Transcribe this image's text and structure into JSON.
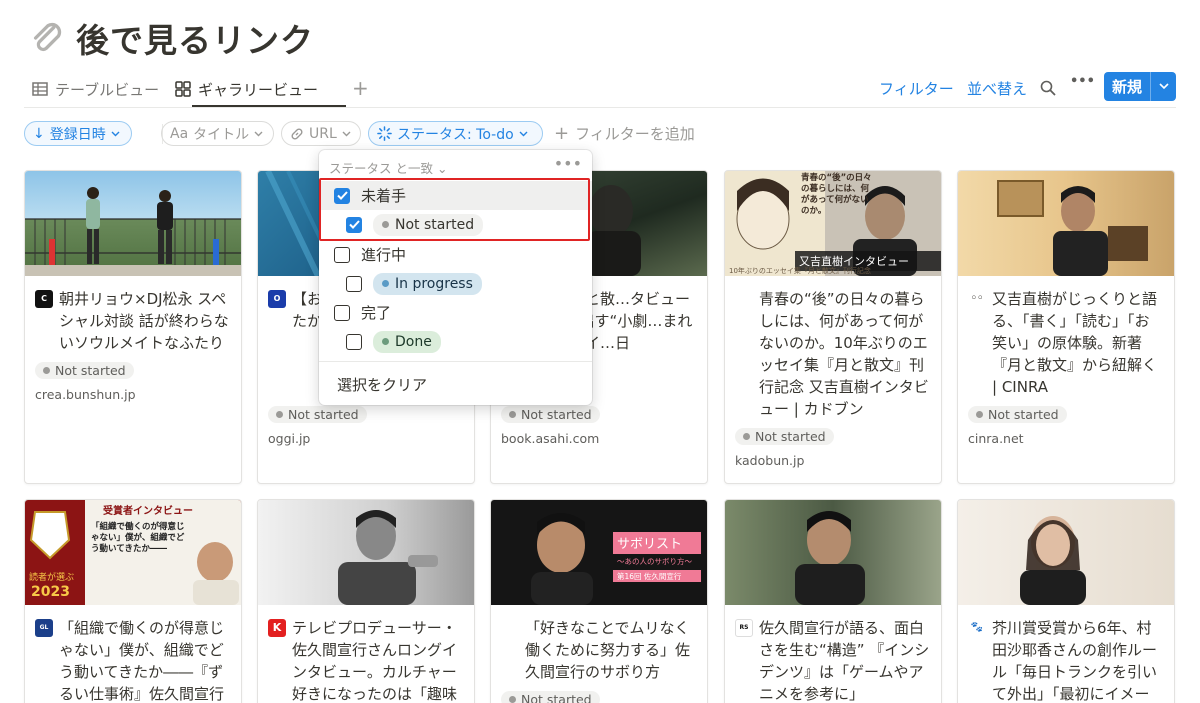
{
  "page": {
    "title": "後で見るリンク"
  },
  "tabs": [
    {
      "label": "テーブルビュー"
    },
    {
      "label": "ギャラリービュー"
    }
  ],
  "toolbar": {
    "filter": "フィルター",
    "sort": "並べ替え",
    "more": "•••",
    "new": "新規"
  },
  "filters": {
    "sort_chip": "登録日時",
    "title_chip": "タイトル",
    "title_prefix": "Aa",
    "url_chip": "URL",
    "status_chip": "ステータス: To-do",
    "add_filter": "フィルターを追加"
  },
  "popup": {
    "header": "ステータス と一致",
    "more": "•••",
    "groups": [
      {
        "label": "未着手",
        "option": "Not started",
        "checked": true
      },
      {
        "label": "進行中",
        "option": "In progress",
        "checked": false
      },
      {
        "label": "完了",
        "option": "Done",
        "checked": false
      }
    ],
    "clear": "選択をクリア"
  },
  "cards": [
    {
      "title": "朝井リョウ×DJ松永 スペシャル対談 話が終わらないソウルメイトなふたり",
      "status": "Not started",
      "site": "crea.bunshun.jp"
    },
    {
      "title": "【おさん…にく…ど、…たか",
      "status": "Not started",
      "site": "oggi.jp"
    },
    {
      "title": "さん「月と散…タビュー 0か…み出す“小劇…まれたエッセイ…日",
      "status": "Not started",
      "site": "book.asahi.com"
    },
    {
      "title": "青春の“後”の日々の暮らしには、何があって何がないのか。10年ぶりのエッセイ集『月と散文』刊行記念 又吉直樹インタビュー | カドブン",
      "status": "Not started",
      "site": "kadobun.jp"
    },
    {
      "title": "又吉直樹がじっくりと語る、「書く」「読む」「お笑い」の原体験。新著『月と散文』から紐解く | CINRA",
      "status": "Not started",
      "site": "cinra.net"
    },
    {
      "title": "「組織で働くのが得意じゃない」僕が、組織でどう動いてきたか――『ずるい仕事術』佐久間宣行",
      "status": "",
      "site": ""
    },
    {
      "title": "テレビプロデューサー・佐久間宣行さんロングインタビュー。カルチャー好きになったのは「趣味",
      "status": "",
      "site": ""
    },
    {
      "title": "「好きなことでムリなく働くために努力する」佐久間宣行のサボり方",
      "status": "Not started",
      "site": ""
    },
    {
      "title": "佐久間宣行が語る、面白さを生む“構造” 『インシデンツ』は「ゲームやアニメを参考に」",
      "status": "",
      "site": ""
    },
    {
      "title": "芥川賞受賞から6年、村田沙耶香さんの創作ルール「毎日トランクを引いて外出」「最初にイメージ",
      "status": "",
      "site": ""
    }
  ],
  "thumbs": {
    "kadobun_overlay": "又吉直樹インタビュー",
    "kadobun_book": "青春の“後”の日々の暮らしには、何があって何がないのか。",
    "kadobun_caption": "10年ぶりのエッセイ集『月と散文』刊行記念",
    "award_title": "受賞者インタビュー",
    "award_quote": "「組織で働くのが得意じゃない」僕が、組織でどう動いてきたか――",
    "award_year": "2023",
    "award_vote": "読者が選ぶ",
    "saboriste": "サボリスト",
    "saboriste_sub": "〜あの人のサボり方〜",
    "saboriste_num": "第16回 佐久間宣行"
  }
}
